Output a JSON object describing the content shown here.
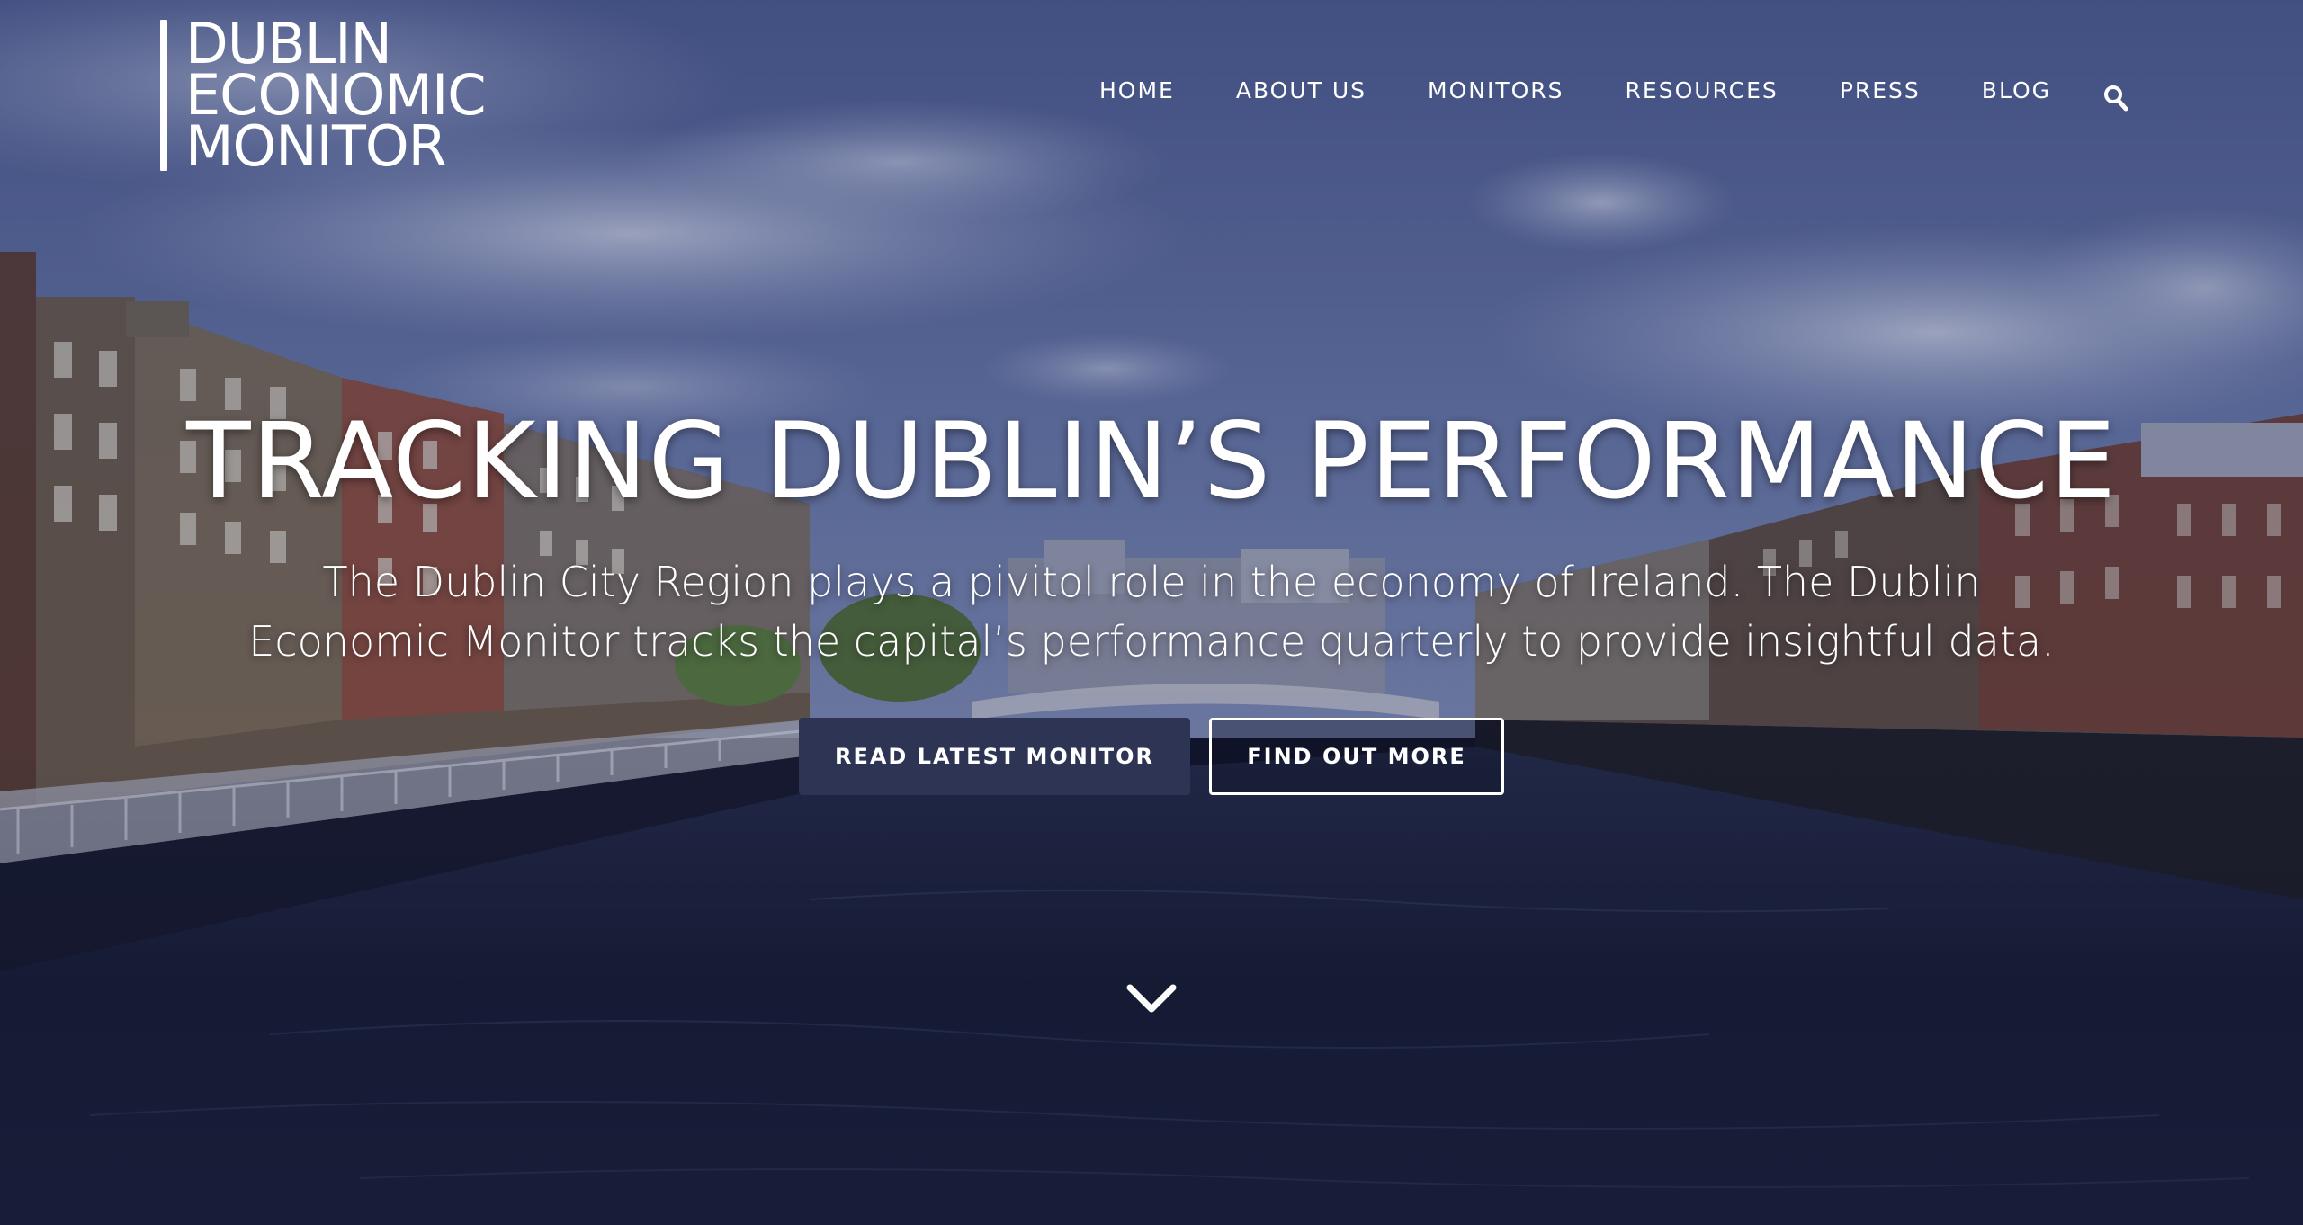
{
  "brand": {
    "logo_line_1": "DUBLIN",
    "logo_line_2": "ECONOMIC",
    "logo_line_3": "MONITOR"
  },
  "nav": {
    "items": [
      {
        "label": "HOME"
      },
      {
        "label": "ABOUT US"
      },
      {
        "label": "MONITORS"
      },
      {
        "label": "RESOURCES"
      },
      {
        "label": "PRESS"
      },
      {
        "label": "BLOG"
      }
    ],
    "search_icon": "search-icon"
  },
  "hero": {
    "title": "TRACKING DUBLIN’S PERFORMANCE",
    "subtitle": "The Dublin City Region plays a pivitol role in the economy of Ireland. The Dublin Economic Monitor tracks the capital’s performance quarterly to provide insightful data.",
    "primary_button": "READ LATEST MONITOR",
    "secondary_button": "FIND OUT MORE",
    "scroll_icon": "chevron-down-icon"
  },
  "colors": {
    "overlay": "#3a4a7e",
    "primary_button": "#2d3454",
    "text": "#ffffff"
  }
}
